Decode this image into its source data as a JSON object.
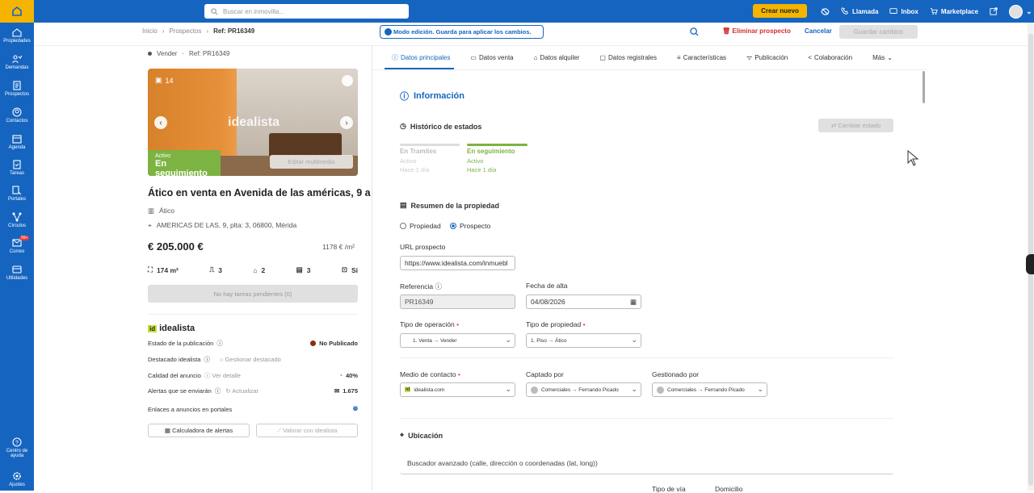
{
  "topbar": {
    "search_placeholder": "Buscar en inmovilla...",
    "create_label": "Crear nuevo",
    "call_label": "Llamada",
    "inbox_label": "Inbox",
    "marketplace_label": "Marketplace"
  },
  "sidebar": {
    "items": [
      {
        "label": "Propiedades",
        "icon": "home-icon"
      },
      {
        "label": "Demandas",
        "icon": "demand-icon"
      },
      {
        "label": "Prospectos",
        "icon": "prospect-icon"
      },
      {
        "label": "Contactos",
        "icon": "contact-icon"
      },
      {
        "label": "Agenda",
        "icon": "calendar-icon"
      },
      {
        "label": "Tareas",
        "icon": "tasks-icon"
      },
      {
        "label": "Portales",
        "icon": "portals-icon"
      },
      {
        "label": "Círculos",
        "icon": "circles-icon"
      },
      {
        "label": "Correo",
        "icon": "mail-icon",
        "badge": "99+"
      },
      {
        "label": "Utilidades",
        "icon": "utilities-icon"
      }
    ],
    "help_label1": "Centro de",
    "help_label2": "ayuda",
    "settings_label": "Ajustes"
  },
  "breadcrumb": {
    "items": [
      "Inicio",
      "Prospectos"
    ],
    "current": "Ref: PR16349"
  },
  "edit_mode": "Modo edición. Guarda para aplicar los cambios.",
  "actions": {
    "delete": "Eliminar prospecto",
    "cancel": "Cancelar",
    "save": "Guardar cambios"
  },
  "property": {
    "operation": "Vender",
    "ref": "Ref: PR16349",
    "photo_count": "14",
    "watermark": "idealista",
    "status_small": "Activo",
    "status_big": "En seguimiento",
    "media_button": "Editar multimedia",
    "title": "Ático en venta en Avenida de las américas, 9 a",
    "type": "Ático",
    "address": "AMERICAS DE LAS, 9, plta: 3, 06800, Mérida",
    "price": "€ 205.000 €",
    "price_m2": "1178 € /m²",
    "area": "174 m²",
    "rooms": "3",
    "baths": "2",
    "floor": "3",
    "extra": "Si",
    "tasks": "No hay tareas pendientes (0)"
  },
  "idealista": {
    "brand_sq": "id",
    "brand": "idealista",
    "pub_state_label": "Estado de la publicación",
    "pub_state_value": "No Publicado",
    "featured_label": "Destacado idealista",
    "featured_value": "Gestionar destacado",
    "quality_label": "Calidad del anuncio",
    "quality_link": "Ver detalle",
    "quality_value": "40%",
    "alerts_label": "Alertas que se enviarán",
    "alerts_link": "Actualizar",
    "alerts_value": "1.675",
    "links_label": "Enlaces a anuncios en portales",
    "calc_button": "Calculadora de alertas",
    "value_button": "Valorar con idealista"
  },
  "tabs": [
    "Datos principales",
    "Datos venta",
    "Datos alquiler",
    "Datos registrales",
    "Características",
    "Publicación",
    "Colaboración",
    "Más"
  ],
  "info": {
    "title": "Información",
    "history_title": "Histórico de estados",
    "change_state": "Cambiar estado",
    "step1_name": "En Tramites",
    "step1_state": "Activo",
    "step1_time": "Hace 1 día",
    "step2_name": "En seguimiento",
    "step2_state": "Activo",
    "step2_time": "Hace 1 día",
    "summary_title": "Resumen de la propiedad",
    "radio_property": "Propiedad",
    "radio_prospect": "Prospecto",
    "url_label": "URL prospecto",
    "url_value": "https://www.idealista.com/inmuebl",
    "ref_label": "Referencia",
    "ref_value": "PR16349",
    "date_label": "Fecha de alta",
    "date_value": "04/08/2026",
    "op_label": "Tipo de operación",
    "op_value": "1. Venta → Vender",
    "ptype_label": "Tipo de propiedad",
    "ptype_value": "1. Piso → Ático",
    "contact_label": "Medio de contacto",
    "contact_value": "idealista.com",
    "captured_label": "Captado por",
    "captured_value": "Comerciales → Fernando Picado",
    "managed_label": "Gestionado por",
    "managed_value": "Comerciales → Fernando Picado",
    "location_title": "Ubicación",
    "location_search": "Buscador avanzado (calle, dirección o coordenadas (lat, long))",
    "road_type": "Tipo de vía",
    "domicile": "Domicilio"
  },
  "colors": {
    "primary": "#1565c0",
    "accent": "#f4b400",
    "active_green": "#7cb342",
    "danger": "#d32f2f"
  }
}
